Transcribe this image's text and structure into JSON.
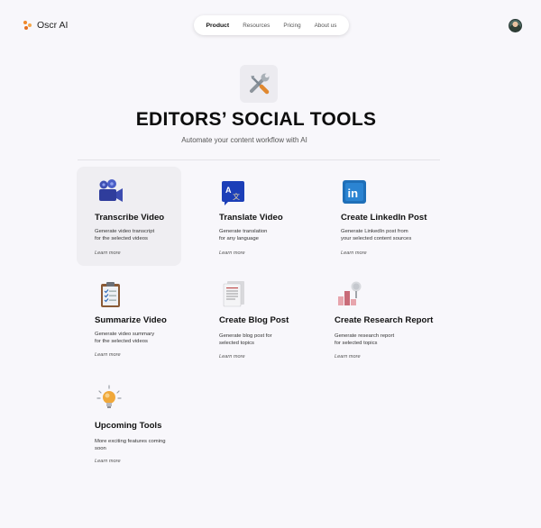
{
  "brand": {
    "name": "Oscr AI"
  },
  "nav": {
    "items": [
      {
        "label": "Product",
        "active": true
      },
      {
        "label": "Resources"
      },
      {
        "label": "Pricing"
      },
      {
        "label": "About us"
      }
    ]
  },
  "hero": {
    "icon": "tools-icon",
    "title": "EDITORS’ SOCIAL TOOLS",
    "subtitle": "Automate your content workflow with AI"
  },
  "tools": [
    {
      "icon": "video-camera-icon",
      "title": "Transcribe Video",
      "desc": [
        "Generate video transcript",
        "for the selected videos"
      ],
      "link": "Learn more",
      "highlighted": true
    },
    {
      "icon": "translate-icon",
      "title": "Translate Video",
      "desc": [
        "Generate translation",
        "for any language"
      ],
      "link": "Learn more"
    },
    {
      "icon": "linkedin-icon",
      "title": "Create LinkedIn Post",
      "desc": [
        "Generate LinkedIn post from",
        "your selected content sources"
      ],
      "link": "Learn more"
    },
    {
      "icon": "clipboard-icon",
      "title": "Summarize Video",
      "desc": [
        "Generate video summary",
        "for the selected videos"
      ],
      "link": "Learn more"
    },
    {
      "icon": "document-icon",
      "title": "Create Blog Post",
      "desc": [
        "Generate blog post for",
        "selected topics"
      ],
      "link": "Learn more"
    },
    {
      "icon": "research-chart-icon",
      "title": "Create Research Report",
      "desc": [
        "Generate research report",
        "for selected topics"
      ],
      "link": "Learn more"
    },
    {
      "icon": "lightbulb-icon",
      "title": "Upcoming Tools",
      "desc": [
        "More exciting features coming",
        "soon"
      ],
      "link": "Learn more"
    }
  ]
}
